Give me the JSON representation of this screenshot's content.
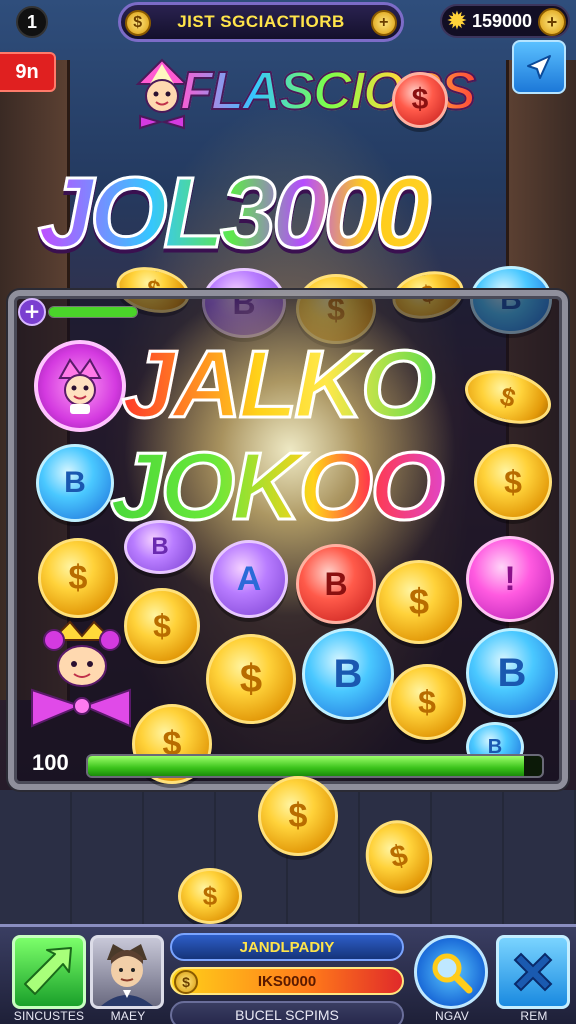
{
  "header": {
    "level": "1",
    "title": "JIST SGCIACTIORB",
    "coins": "159000"
  },
  "timer_label": "9n",
  "logo_text": "FLASCIORS",
  "jackpot_text": "JOL3000",
  "bonus_line1": "JALKO",
  "bonus_line2": "JOKOO",
  "progress": {
    "value_label": "100",
    "fill_fraction": 0.96
  },
  "bottom_bar": {
    "left_button_label": "SINCUSTES",
    "avatar_label": "MAEY",
    "panel_title": "JANDLPADIY",
    "panel_amount": "IKS0000",
    "panel_subtitle": "BUCEL SCPIMS",
    "search_label": "NGAV",
    "close_label": "REM"
  },
  "colors": {
    "accent_gold": "#ffd23a",
    "progress_green": "#3ac21a",
    "panel_blue": "#2e5ec8",
    "timer_red": "#e02020"
  },
  "icons": [
    "star-coin-icon",
    "plus-icon",
    "share-arrow-icon",
    "arrow-icon",
    "search-icon",
    "close-x-icon",
    "coin-icon"
  ]
}
